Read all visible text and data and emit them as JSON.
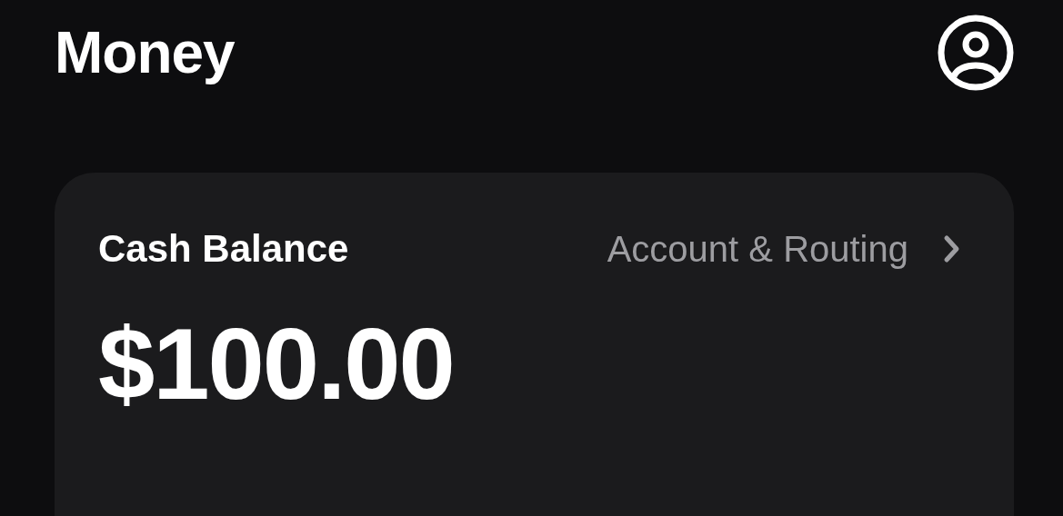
{
  "header": {
    "title": "Money"
  },
  "balance_card": {
    "title": "Cash Balance",
    "link": "Account & Routing",
    "amount": "$100.00"
  }
}
